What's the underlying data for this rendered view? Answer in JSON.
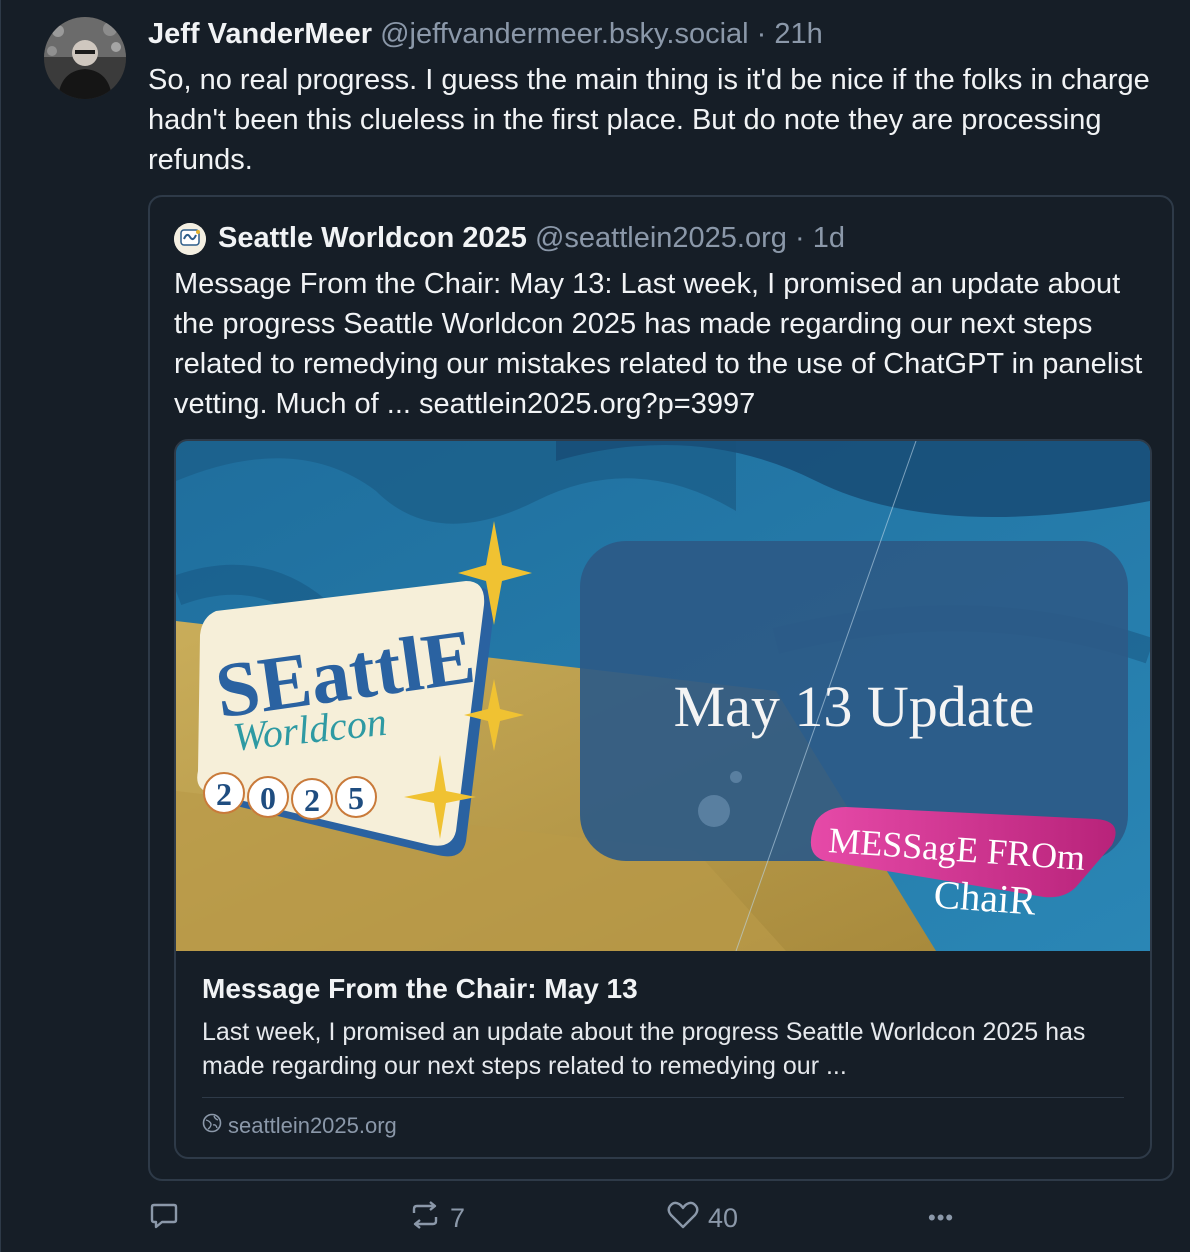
{
  "post": {
    "author_name": "Jeff VanderMeer",
    "handle": "@jeffvandermeer.bsky.social",
    "separator": "·",
    "time": "21h",
    "text": "So, no real progress. I guess the main thing is it'd be nice if the folks in charge hadn't been this clueless in the first place. But do note they are processing refunds."
  },
  "quote": {
    "author_name": "Seattle Worldcon 2025",
    "handle": "@seattlein2025.org",
    "separator": "·",
    "time": "1d",
    "text": "Message From the Chair: May 13: Last week, I promised an update about the progress Seattle Worldcon 2025 has made regarding our next steps related to remedying our mistakes related to the use of ChatGPT in panelist vetting. Much of ... seattlein2025.org?p=3997"
  },
  "card": {
    "image": {
      "logo_line1": "SEattlE",
      "logo_line2": "Worldcon",
      "logo_digits": [
        "2",
        "0",
        "2",
        "5"
      ],
      "headline": "May 13 Update",
      "badge_line1": "MESSagE FROm",
      "badge_line2": "ChaiR"
    },
    "title": "Message From the Chair: May 13",
    "description": "Last week, I promised an update about the progress Seattle Worldcon 2025 has made regarding our next steps related to remedying our ...",
    "domain": "seattlein2025.org"
  },
  "actions": {
    "reply_count": "",
    "repost_count": "7",
    "like_count": "40",
    "more_label": "•••"
  },
  "colors": {
    "background": "#161e27",
    "border": "#2e3a48",
    "text": "#f1f3f5",
    "muted": "#8b98a9"
  },
  "icons": [
    "reply-icon",
    "repost-icon",
    "heart-icon",
    "more-icon",
    "globe-icon"
  ]
}
